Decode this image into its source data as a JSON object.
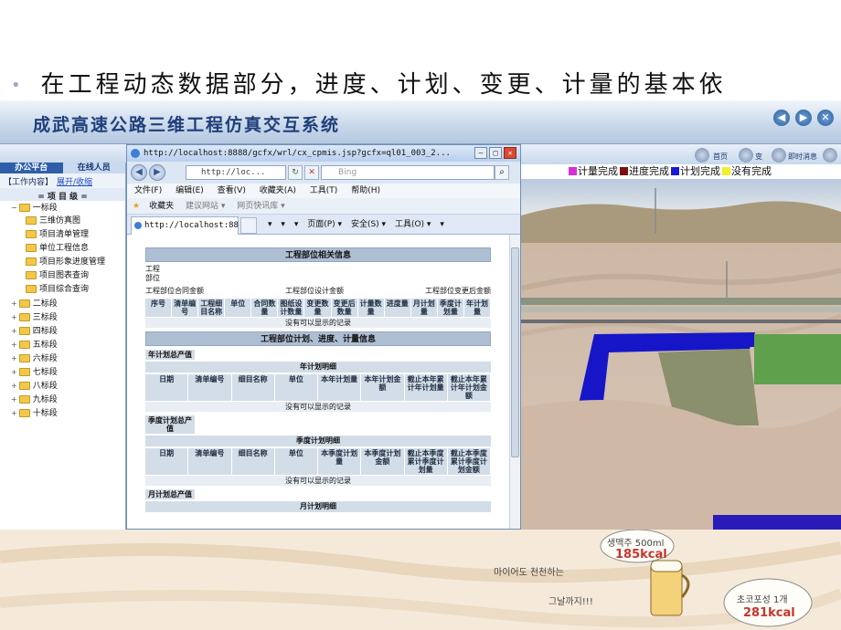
{
  "slide": {
    "bullet": "•",
    "heading": "在工程动态数据部分，进度、计划、变更、计量的基本依"
  },
  "app": {
    "title": "成武高速公路三维工程仿真交互系统",
    "nav_back": "◀",
    "nav_forward": "▶",
    "nav_close": "✕"
  },
  "sidebar": {
    "tabs": [
      "办公平台",
      "在线人员"
    ],
    "work_label": "【工作内容】",
    "work_link": "展开/收缩",
    "level_header": "= 项 目 级 =",
    "items": [
      {
        "label": "一标段",
        "level": "top",
        "expanded": true
      },
      {
        "label": "三维仿真图",
        "level": "sub"
      },
      {
        "label": "项目清单管理",
        "level": "sub"
      },
      {
        "label": "单位工程信息",
        "level": "sub"
      },
      {
        "label": "项目形象进度管理",
        "level": "sub"
      },
      {
        "label": "项目图表查询",
        "level": "sub"
      },
      {
        "label": "项目综合查询",
        "level": "sub"
      },
      {
        "label": "二标段",
        "level": "top"
      },
      {
        "label": "三标段",
        "level": "top"
      },
      {
        "label": "四标段",
        "level": "top"
      },
      {
        "label": "五标段",
        "level": "top"
      },
      {
        "label": "六标段",
        "level": "top"
      },
      {
        "label": "七标段",
        "level": "top"
      },
      {
        "label": "八标段",
        "level": "top"
      },
      {
        "label": "九标段",
        "level": "top"
      },
      {
        "label": "十标段",
        "level": "top"
      }
    ]
  },
  "browser": {
    "title": "http://localhost:8888/gcfx/wrl/cx_cpmis.jsp?gcfx=ql01_003_2...",
    "min": "–",
    "max": "□",
    "close": "✕",
    "address": "http://loc...",
    "search_placeholder": "Bing",
    "menu": [
      "文件(F)",
      "编辑(E)",
      "查看(V)",
      "收藏夹(A)",
      "工具(T)",
      "帮助(H)"
    ],
    "favorites": "收藏夹",
    "fav_items": [
      "建议网站 ▾",
      "网页快讯库 ▾"
    ],
    "tab_title": "http://localhost:88...",
    "tools": [
      "▾",
      "▾",
      "▾",
      "页面(P) ▾",
      "安全(S) ▾",
      "工具(O) ▾",
      "▾"
    ]
  },
  "document": {
    "section1_title": "工程部位相关信息",
    "part_label": "工程\n部位",
    "amount_labels": [
      "工程部位合同金额",
      "工程部位设计金额",
      "工程部位变更后金额"
    ],
    "columns1": [
      "序号",
      "清单编号",
      "工程细目名称",
      "单位",
      "合同数量",
      "图纸设计数量",
      "变更数量",
      "变更后数量",
      "计量数量",
      "进度量",
      "月计划量",
      "季度计划量",
      "年计划量"
    ],
    "no_data": "没有可以显示的记录",
    "section2_title": "工程部位计划、进度、计量信息",
    "year_total_label": "年计划总产值",
    "year_detail": "年计划明细",
    "year_columns": [
      "日期",
      "清单编号",
      "细目名称",
      "单位",
      "本年计划量",
      "本年计划金额",
      "截止本年累计年计划量",
      "截止本年累计年计划金额"
    ],
    "quarter_total_label": "季度计划总产值",
    "quarter_detail": "季度计划明细",
    "quarter_columns": [
      "日期",
      "清单编号",
      "细目名称",
      "单位",
      "本季度计划量",
      "本季度计划金额",
      "截止本季度累计季度计划量",
      "截止本季度累计季度计划金额"
    ],
    "month_total_label": "月计划总产值",
    "month_detail": "月计划明细"
  },
  "viewer": {
    "home": "首页",
    "change": "变",
    "instant_news": "即时消息",
    "legend": [
      {
        "label": "计量完成",
        "color": "#d62fd6"
      },
      {
        "label": "进度完成",
        "color": "#7a1010"
      },
      {
        "label": "计划完成",
        "color": "#1a1ad0"
      },
      {
        "label": "没有完成",
        "color": "#f3f02a"
      }
    ]
  },
  "decor": {
    "line1": "생맥주 500ml",
    "kcal1": "185kcal",
    "line2": "마이어도 천천하는",
    "line3": "그날까지!!!",
    "line4": "초코포성 1개",
    "kcal2": "281kcal"
  }
}
